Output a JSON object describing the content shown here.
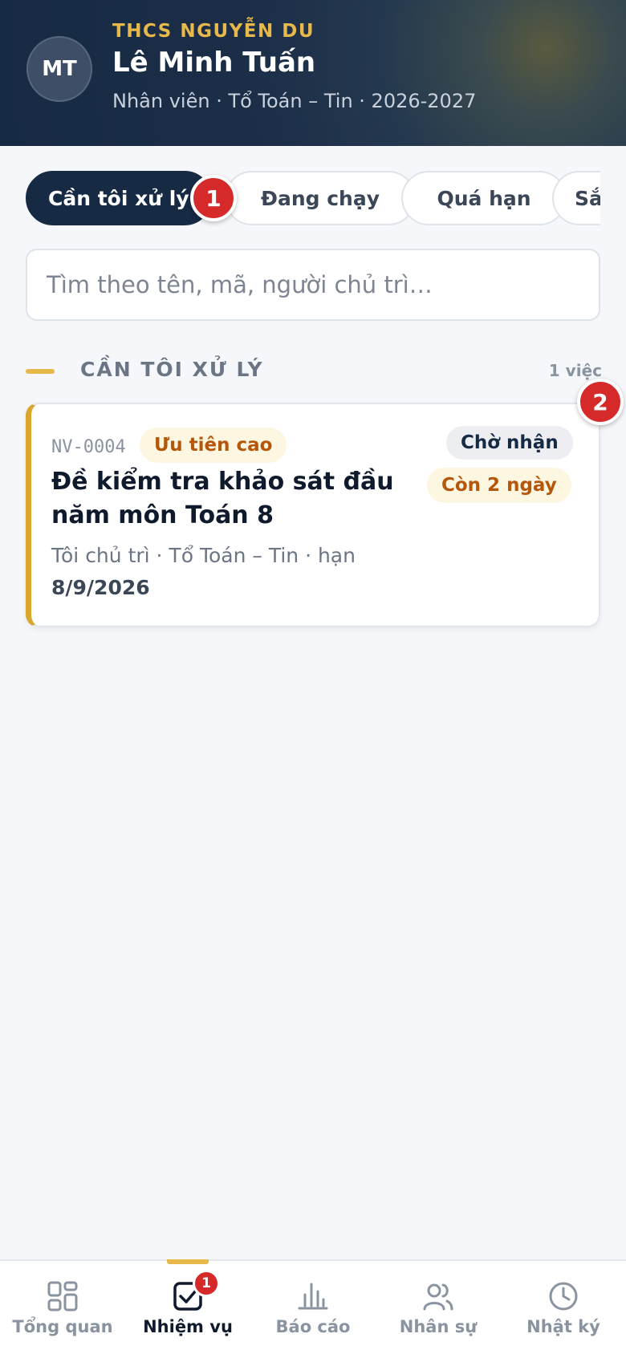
{
  "header": {
    "avatar_initials": "MT",
    "school": "THCS NGUYỄN DU",
    "user_name": "Lê Minh Tuấn",
    "subtitle": "Nhân viên · Tổ Toán – Tin · 2026-2027"
  },
  "tabs": [
    {
      "label": "Cần tôi xử lý",
      "active": true
    },
    {
      "label": "Đang chạy",
      "active": false
    },
    {
      "label": "Quá hạn",
      "active": false
    },
    {
      "label": "Sắ",
      "active": false
    }
  ],
  "step_markers": [
    "1",
    "2"
  ],
  "search": {
    "placeholder": "Tìm theo tên, mã, người chủ trì…",
    "value": ""
  },
  "section": {
    "title": "CẦN TÔI XỬ LÝ",
    "count": "1 việc"
  },
  "tasks": [
    {
      "code": "NV-0004",
      "priority": "Ưu tiên cao",
      "status": "Chờ nhận",
      "due_badge": "Còn 2 ngày",
      "title": "Đề kiểm tra khảo sát đầu năm môn Toán 8",
      "meta": "Tôi chủ trì · Tổ Toán – Tin · hạn",
      "deadline": "8/9/2026"
    }
  ],
  "bottom_nav": {
    "items": [
      {
        "label": "Tổng quan",
        "icon": "grid-icon",
        "active": false
      },
      {
        "label": "Nhiệm vụ",
        "icon": "checkbox-icon",
        "active": true,
        "badge": "1"
      },
      {
        "label": "Báo cáo",
        "icon": "bar-chart-icon",
        "active": false
      },
      {
        "label": "Nhân sự",
        "icon": "users-icon",
        "active": false
      },
      {
        "label": "Nhật ký",
        "icon": "clock-icon",
        "active": false
      }
    ]
  },
  "colors": {
    "navy": "#172a44",
    "accent_gold": "#e7b84a",
    "danger": "#d62a2a",
    "warning_text": "#b5570a"
  }
}
